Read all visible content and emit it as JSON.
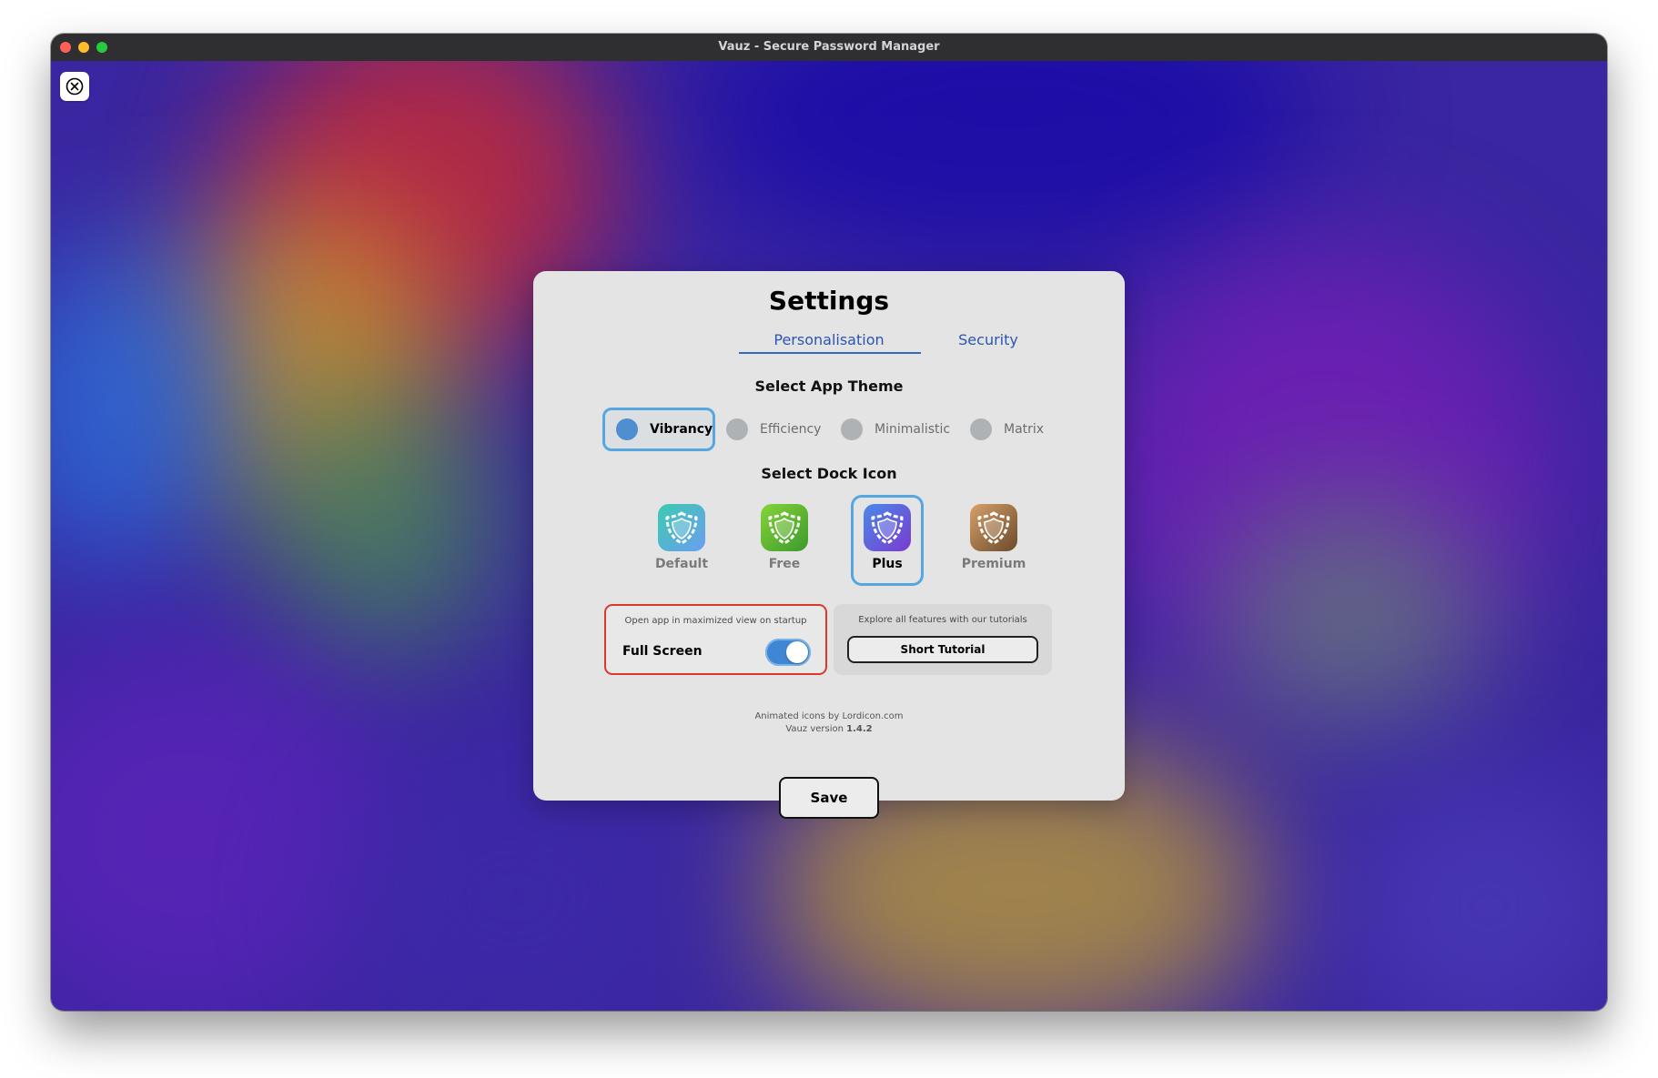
{
  "window": {
    "title": "Vauz - Secure Password Manager"
  },
  "modal": {
    "title": "Settings",
    "tabs": [
      {
        "label": "Personalisation",
        "active": true
      },
      {
        "label": "Security",
        "active": false
      }
    ],
    "theme_section": {
      "title": "Select App Theme",
      "options": [
        {
          "label": "Vibrancy",
          "selected": true
        },
        {
          "label": "Efficiency",
          "selected": false
        },
        {
          "label": "Minimalistic",
          "selected": false
        },
        {
          "label": "Matrix",
          "selected": false
        }
      ]
    },
    "dock_section": {
      "title": "Select Dock Icon",
      "options": [
        {
          "label": "Default",
          "selected": false,
          "icon": "shield-icon",
          "colors": [
            "#3ccbb0",
            "#6a9ef0"
          ]
        },
        {
          "label": "Free",
          "selected": false,
          "icon": "shield-icon",
          "colors": [
            "#86d43a",
            "#3c9a2c"
          ]
        },
        {
          "label": "Plus",
          "selected": true,
          "icon": "shield-icon",
          "colors": [
            "#4a8ae8",
            "#7a3ad0"
          ]
        },
        {
          "label": "Premium",
          "selected": false,
          "icon": "shield-icon",
          "colors": [
            "#d6a06a",
            "#6b4a2a"
          ]
        }
      ]
    },
    "fullscreen_card": {
      "caption": "Open app in maximized view on startup",
      "label": "Full Screen",
      "enabled": true
    },
    "tutorial_card": {
      "caption": "Explore all features with our tutorials",
      "button_label": "Short Tutorial"
    },
    "credits": {
      "icons_credit": "Animated icons by Lordicon.com",
      "version_prefix": "Vauz version",
      "version": "1.4.2"
    },
    "save_label": "Save"
  },
  "colors": {
    "accent": "#3468c2",
    "selection_border": "#56a7e0",
    "toggle_on": "#3f87d4",
    "danger_border": "#d9392d"
  }
}
